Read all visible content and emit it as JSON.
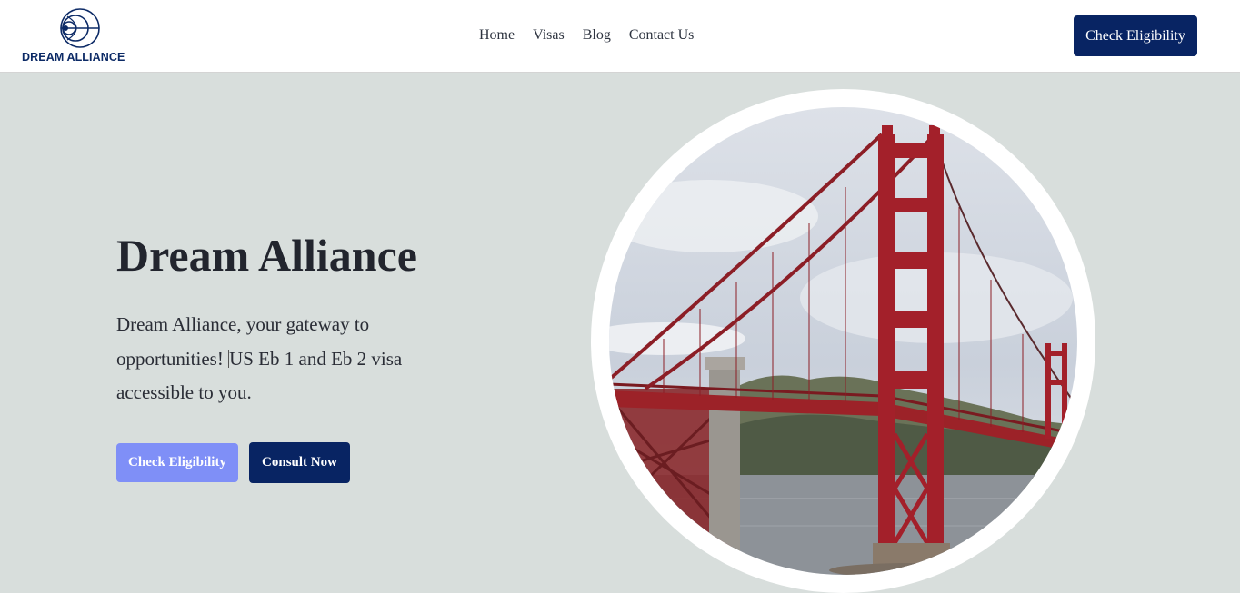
{
  "header": {
    "logo_text": "DREAM ALLIANCE",
    "logo_icon": "concentric-circles-logo-icon",
    "nav": [
      "Home",
      "Visas",
      "Blog",
      "Contact Us"
    ],
    "cta_label": "Check Eligibility"
  },
  "hero": {
    "title": "Dream Alliance",
    "text_part1": "Dream Alliance, your gateway to opportunities! ",
    "text_part2": "US Eb 1 and Eb 2 visa accessible to you.",
    "primary_button": "Check Eligibility",
    "secondary_button": "Consult Now",
    "image_subject": "golden-gate-bridge-photo"
  },
  "colors": {
    "navy": "#082463",
    "periwinkle": "#7f8ff7",
    "hero_background": "#d8dedc",
    "bridge_red": "#a3202a"
  }
}
